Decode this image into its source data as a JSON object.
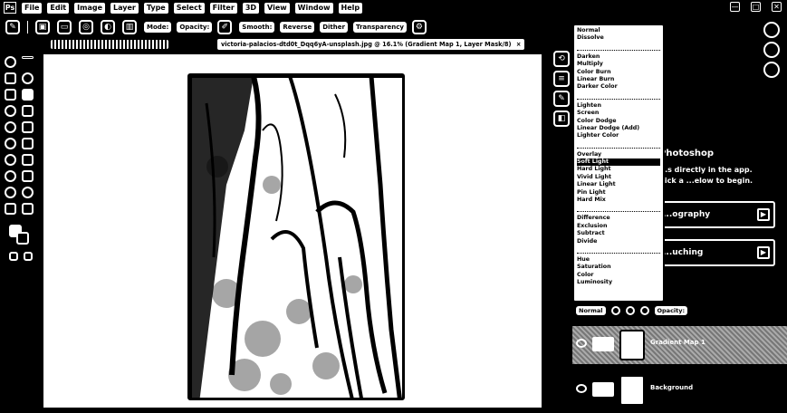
{
  "menubar": {
    "logo": "Ps",
    "items": [
      "File",
      "Edit",
      "Image",
      "Layer",
      "Type",
      "Select",
      "Filter",
      "3D",
      "View",
      "Window",
      "Help"
    ],
    "window_controls": [
      "—",
      "□",
      "✕"
    ]
  },
  "options": {
    "pills": [
      "Mode:",
      "Opacity:",
      "Smooth:",
      "Reverse",
      "Dither",
      "Transparency"
    ]
  },
  "document_tab": {
    "label": "victoria-palacios-dtd0t_Dqq6yA-unsplash.jpg @ 16.1% (Gradient Map 1, Layer Mask/8)",
    "close": "×"
  },
  "blend_modes": {
    "groups": [
      [
        "Normal",
        "Dissolve"
      ],
      [
        "Darken",
        "Multiply",
        "Color Burn",
        "Linear Burn",
        "Darker Color"
      ],
      [
        "Lighten",
        "Screen",
        "Color Dodge",
        "Linear Dodge (Add)",
        "Lighter Color"
      ],
      [
        "Overlay",
        "Soft Light",
        "Hard Light",
        "Vivid Light",
        "Linear Light",
        "Pin Light",
        "Hard Mix"
      ],
      [
        "Difference",
        "Exclusion",
        "Subtract",
        "Divide"
      ],
      [
        "Hue",
        "Saturation",
        "Color",
        "Luminosity"
      ]
    ],
    "hovered": "Soft Light"
  },
  "learn_panel": {
    "title": "Photoshop",
    "description": "...s directly in the app. Pick a ...elow to begin.",
    "cards": [
      "...ography",
      "...uching"
    ]
  },
  "layers": {
    "bar_pills": [
      "Normal",
      "Opacity:"
    ],
    "rows": [
      {
        "name": "Gradient Map 1",
        "selected": true
      },
      {
        "name": "Background",
        "selected": false
      }
    ]
  }
}
